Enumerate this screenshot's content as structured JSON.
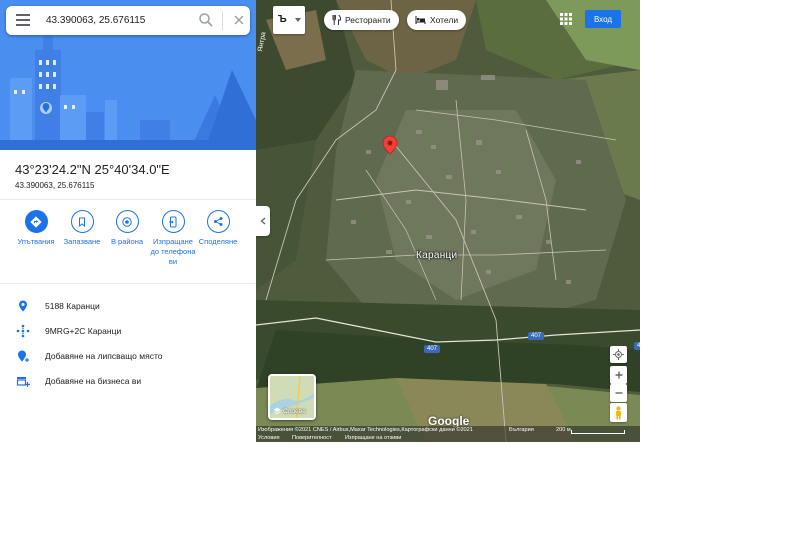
{
  "search": {
    "value": "43.390063, 25.676115"
  },
  "place": {
    "title": "43°23'24.2\"N 25°40'34.0\"E",
    "subtitle": "43.390063, 25.676115"
  },
  "actions": [
    {
      "label": "Упътвания",
      "icon": "directions-icon"
    },
    {
      "label": "Запазване",
      "icon": "bookmark-icon"
    },
    {
      "label": "В района",
      "icon": "nearby-icon"
    },
    {
      "label": "Изпращане до телефона ви",
      "icon": "send-to-phone-icon"
    },
    {
      "label": "Споделяне",
      "icon": "share-icon"
    }
  ],
  "info_rows": [
    {
      "text": "5188 Каранци",
      "icon": "location-pin-icon"
    },
    {
      "text": "9MRG+2C Каранци",
      "icon": "plus-code-icon"
    },
    {
      "text": "Добавяне на липсващо място",
      "icon": "add-place-icon"
    },
    {
      "text": "Добавяне на бизнеса ви",
      "icon": "add-business-icon"
    }
  ],
  "map": {
    "language_button": "Ъ",
    "chips": [
      {
        "label": "Ресторанти",
        "icon": "restaurant-icon"
      },
      {
        "label": "Хотели",
        "icon": "hotel-icon"
      }
    ],
    "signin_label": "Вход",
    "place_label": "Каранци",
    "road_labels": [
      "407",
      "407",
      "4"
    ],
    "road_name": "Янтра",
    "layers_label": "Слоеве",
    "logo": "Google",
    "footer": {
      "imagery": "Изображения ©2021 CNES / Airbus,Maxar Technologies,Картографски данни ©2021",
      "country": "България",
      "scale": "200 м",
      "terms": "Условия",
      "privacy": "Поверителност",
      "feedback": "Изпращане на отзиви"
    }
  },
  "colors": {
    "accent": "#1a73e8",
    "hero_sky": "#4a8ef0",
    "pin": "#ea4335",
    "badge": "#3b6bb7"
  }
}
